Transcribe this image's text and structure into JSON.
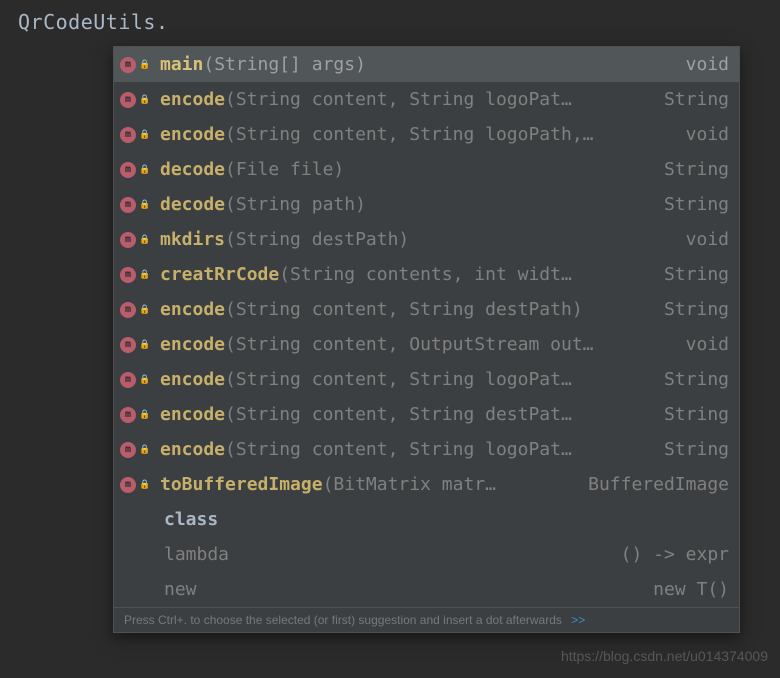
{
  "editor": {
    "code": "QrCodeUtils."
  },
  "suggestions": [
    {
      "icon": true,
      "name": "main",
      "params": "(String[] args)",
      "returnType": "void",
      "selected": true
    },
    {
      "icon": true,
      "name": "encode",
      "params": "(String content, String logoPat…",
      "returnType": "String"
    },
    {
      "icon": true,
      "name": "encode",
      "params": "(String content, String logoPath,…",
      "returnType": "void"
    },
    {
      "icon": true,
      "name": "decode",
      "params": "(File file)",
      "returnType": "String"
    },
    {
      "icon": true,
      "name": "decode",
      "params": "(String path)",
      "returnType": "String"
    },
    {
      "icon": true,
      "name": "mkdirs",
      "params": "(String destPath)",
      "returnType": "void"
    },
    {
      "icon": true,
      "name": "creatRrCode",
      "params": "(String contents, int widt…",
      "returnType": "String"
    },
    {
      "icon": true,
      "name": "encode",
      "params": "(String content, String destPath)",
      "returnType": "String"
    },
    {
      "icon": true,
      "name": "encode",
      "params": "(String content, OutputStream out…",
      "returnType": "void"
    },
    {
      "icon": true,
      "name": "encode",
      "params": "(String content, String logoPat…",
      "returnType": "String"
    },
    {
      "icon": true,
      "name": "encode",
      "params": "(String content, String destPat…",
      "returnType": "String"
    },
    {
      "icon": true,
      "name": "encode",
      "params": "(String content, String logoPat…",
      "returnType": "String"
    },
    {
      "icon": true,
      "name": "toBufferedImage",
      "params": "(BitMatrix matr…",
      "returnType": "BufferedImage"
    },
    {
      "icon": false,
      "name": "class",
      "params": "",
      "returnType": "",
      "kind": "keyword"
    },
    {
      "icon": false,
      "name": "lambda",
      "params": "",
      "returnType": "() -> expr",
      "kind": "dim"
    },
    {
      "icon": false,
      "name": "new",
      "params": "",
      "returnType": "new T()",
      "kind": "dim"
    }
  ],
  "hint": {
    "text": "Press Ctrl+. to choose the selected (or first) suggestion and insert a dot afterwards"
  },
  "watermark": "https://blog.csdn.net/u014374009"
}
